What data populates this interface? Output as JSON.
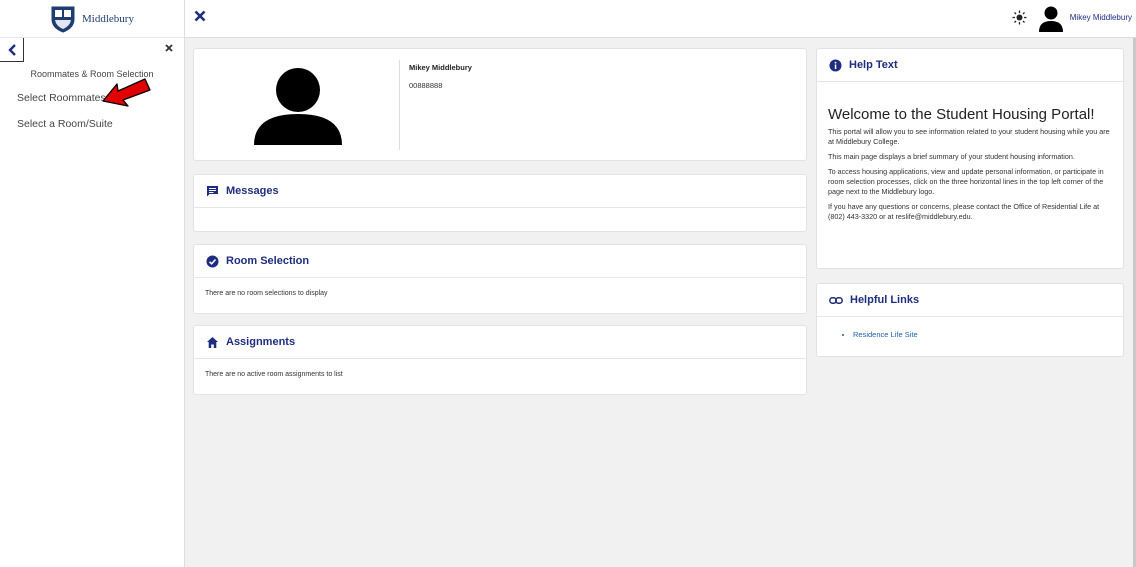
{
  "sidebar": {
    "logo_text": "Middlebury",
    "section_title": "Roommates & Room Selection",
    "items": [
      {
        "label": "Select Roommates"
      },
      {
        "label": "Select a Room/Suite"
      }
    ]
  },
  "topbar": {
    "user_name": "Mikey Middlebury"
  },
  "profile": {
    "name": "Mikey Middlebury",
    "id": "00888888"
  },
  "messages": {
    "title": "Messages"
  },
  "room_selection": {
    "title": "Room Selection",
    "empty_text": "There are no room selections to display"
  },
  "assignments": {
    "title": "Assignments",
    "empty_text": "There are no active room assignments to list"
  },
  "help": {
    "title": "Help Text",
    "heading": "Welcome to the Student Housing Portal!",
    "paragraphs": [
      "This portal will allow you to see information related to your student housing while you are at Middlebury College.",
      "This main page displays a brief summary of your student housing information.",
      "To access housing applications, view and update personal information, or participate in room selection processes, click on the three horizontal lines in the top left corner of the page next to the Middlebury logo.",
      "If you have any questions or concerns, please contact the Office of Residential Life at (802) 443-3320 or at reslife@middlebury.edu."
    ]
  },
  "links": {
    "title": "Helpful Links",
    "items": [
      {
        "label": "Residence Life Site"
      }
    ]
  },
  "colors": {
    "brand_navy": "#1f2d80",
    "link_blue": "#1f5fa8",
    "annotation_red": "#e00000"
  }
}
